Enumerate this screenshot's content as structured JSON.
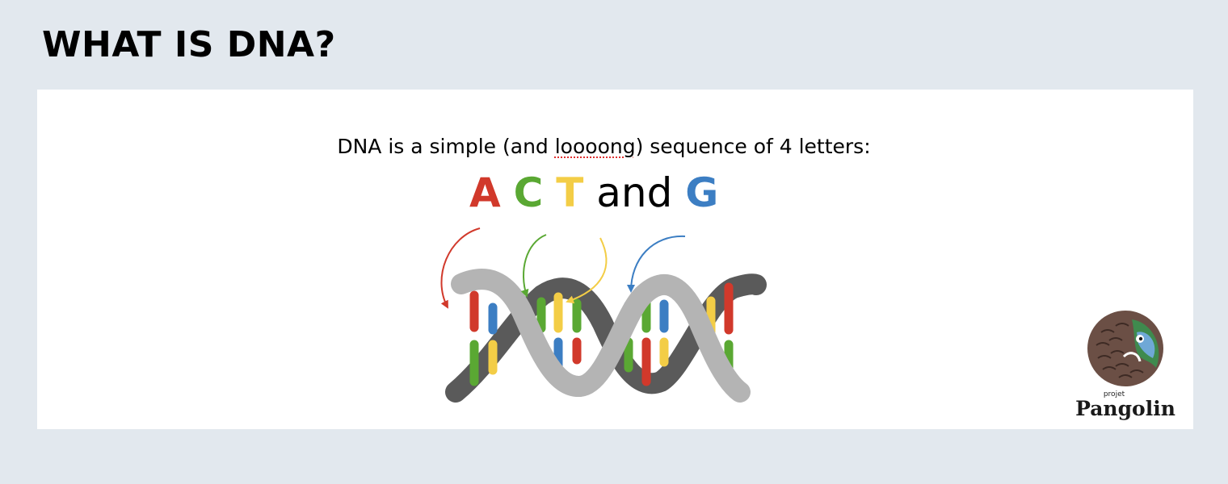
{
  "slide": {
    "title": "WHAT IS DNA?"
  },
  "intro": {
    "before": "DNA is a simple (and ",
    "misspelled": "loooong",
    "after": ") sequence of 4 letters:"
  },
  "bases": {
    "a": "A",
    "c": "C",
    "t": "T",
    "conjunction": "and",
    "g": "G"
  },
  "logo": {
    "small_text": "projet",
    "name": "Pangolin"
  },
  "colors": {
    "background": "#e2e8ee",
    "panel": "#ffffff",
    "adenine": "#d1392b",
    "cytosine": "#5aa833",
    "thymine": "#f3cd46",
    "guanine": "#3c7ec3",
    "helix_back": "#5a5a5a",
    "helix_front": "#b4b4b4"
  },
  "icons": [
    "dna-double-helix-icon",
    "pangolin-logo-icon",
    "curved-arrow-icon"
  ]
}
